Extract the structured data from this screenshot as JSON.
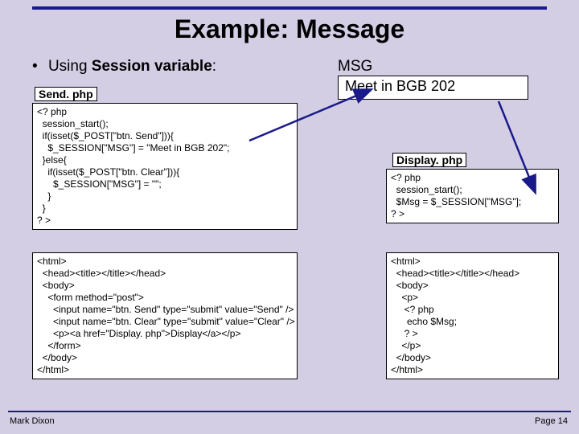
{
  "title": "Example: Message",
  "bullet": {
    "prefix": "Using ",
    "bold": "Session variable",
    "suffix": ":"
  },
  "send_label": "Send. php",
  "msg_label": "MSG",
  "msg_value": "Meet in BGB 202",
  "display_label": "Display. php",
  "send_code_top": "<? php\n  session_start();\n  if(isset($_POST[\"btn. Send\"])){\n    $_SESSION[\"MSG\"] = \"Meet in BGB 202\";\n  }else{\n    if(isset($_POST[\"btn. Clear\"])){\n      $_SESSION[\"MSG\"] = \"\";\n    }\n  }\n? >",
  "send_code_bottom": "<html>\n  <head><title></title></head>\n  <body>\n    <form method=\"post\">\n      <input name=\"btn. Send\" type=\"submit\" value=\"Send\" />\n      <input name=\"btn. Clear\" type=\"submit\" value=\"Clear\" />\n      <p><a href=\"Display. php\">Display</a></p>\n    </form>\n  </body>\n</html>",
  "display_code_top": "<? php\n  session_start();\n  $Msg = $_SESSION[\"MSG\"];\n? >",
  "display_code_bottom": "<html>\n  <head><title></title></head>\n  <body>\n    <p>\n     <? php\n      echo $Msg;\n     ? >\n    </p>\n  </body>\n</html>",
  "footer_left": "Mark Dixon",
  "footer_right": "Page 14"
}
